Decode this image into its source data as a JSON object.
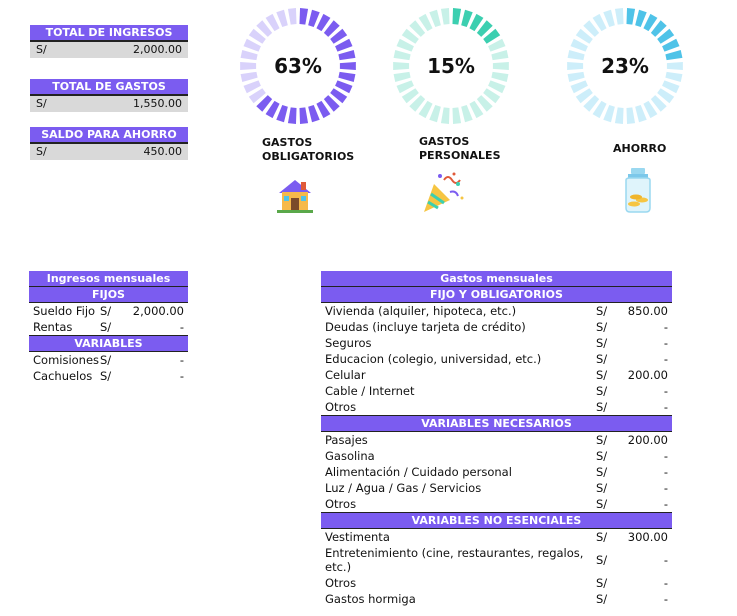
{
  "summary": [
    {
      "label": "TOTAL DE INGRESOS",
      "currency": "S/",
      "value": "2,000.00"
    },
    {
      "label": "TOTAL DE GASTOS",
      "currency": "S/",
      "value": "1,550.00"
    },
    {
      "label": "SALDO PARA AHORRO",
      "currency": "S/",
      "value": "450.00"
    }
  ],
  "donuts": [
    {
      "percent": "63%",
      "fraction": 0.63,
      "label_line1": "GASTOS",
      "label_line2": "OBLIGATORIOS",
      "fill_color": "#7b5cf0",
      "empty_color": "#d9d2fb",
      "icon": "house-icon"
    },
    {
      "percent": "15%",
      "fraction": 0.15,
      "label_line1": "GASTOS",
      "label_line2": "PERSONALES",
      "fill_color": "#3ccfb0",
      "empty_color": "#c8f1e8",
      "icon": "party-popper-icon"
    },
    {
      "percent": "23%",
      "fraction": 0.23,
      "label_line1": "AHORRO",
      "label_line2": "",
      "fill_color": "#4fc3e8",
      "empty_color": "#cdeefa",
      "icon": "savings-jar-icon"
    }
  ],
  "ingresos": {
    "title": "Ingresos mensuales",
    "sections": [
      {
        "name": "FIJOS",
        "rows": [
          {
            "label": "Sueldo Fijo",
            "currency": "S/",
            "value": "2,000.00"
          },
          {
            "label": "Rentas",
            "currency": "S/",
            "value": "-"
          }
        ]
      },
      {
        "name": "VARIABLES",
        "rows": [
          {
            "label": "Comisiones",
            "currency": "S/",
            "value": "-"
          },
          {
            "label": "Cachuelos",
            "currency": "S/",
            "value": "-"
          }
        ]
      }
    ]
  },
  "gastos": {
    "title": "Gastos mensuales",
    "sections": [
      {
        "name": "FIJO Y OBLIGATORIOS",
        "rows": [
          {
            "label": "Vivienda (alquiler, hipoteca, etc.)",
            "currency": "S/",
            "value": "850.00"
          },
          {
            "label": "Deudas (incluye tarjeta de crédito)",
            "currency": "S/",
            "value": "-"
          },
          {
            "label": "Seguros",
            "currency": "S/",
            "value": "-"
          },
          {
            "label": "Educacion (colegio, universidad, etc.)",
            "currency": "S/",
            "value": "-"
          },
          {
            "label": "Celular",
            "currency": "S/",
            "value": "200.00"
          },
          {
            "label": "Cable / Internet",
            "currency": "S/",
            "value": "-"
          },
          {
            "label": "Otros",
            "currency": "S/",
            "value": "-"
          }
        ]
      },
      {
        "name": "VARIABLES NECESARIOS",
        "rows": [
          {
            "label": "Pasajes",
            "currency": "S/",
            "value": "200.00"
          },
          {
            "label": "Gasolina",
            "currency": "S/",
            "value": "-"
          },
          {
            "label": "Alimentación / Cuidado personal",
            "currency": "S/",
            "value": "-"
          },
          {
            "label": "Luz / Agua / Gas / Servicios",
            "currency": "S/",
            "value": "-"
          },
          {
            "label": "Otros",
            "currency": "S/",
            "value": "-"
          }
        ]
      },
      {
        "name": "VARIABLES NO ESENCIALES",
        "rows": [
          {
            "label": "Vestimenta",
            "currency": "S/",
            "value": "300.00"
          },
          {
            "label": "Entretenimiento (cine, restaurantes, regalos, etc.)",
            "currency": "S/",
            "value": "-"
          },
          {
            "label": "Otros",
            "currency": "S/",
            "value": "-"
          },
          {
            "label": "Gastos hormiga",
            "currency": "S/",
            "value": "-"
          }
        ]
      }
    ]
  }
}
